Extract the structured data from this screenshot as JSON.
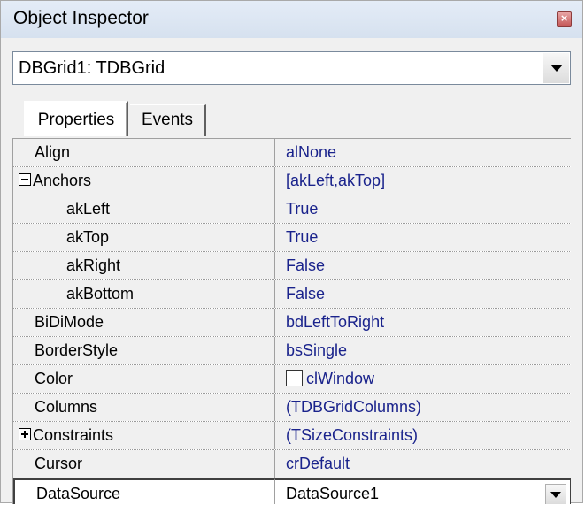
{
  "window": {
    "title": "Object Inspector",
    "close_icon": "close-icon"
  },
  "component_selector": {
    "value": "DBGrid1: TDBGrid"
  },
  "tabs": [
    {
      "label": "Properties",
      "active": true
    },
    {
      "label": "Events",
      "active": false
    }
  ],
  "properties": [
    {
      "name": "Align",
      "value": "alNone",
      "level": 0
    },
    {
      "name": "Anchors",
      "value": "[akLeft,akTop]",
      "level": 0,
      "expander": "minus"
    },
    {
      "name": "akLeft",
      "value": "True",
      "level": 1
    },
    {
      "name": "akTop",
      "value": "True",
      "level": 1
    },
    {
      "name": "akRight",
      "value": "False",
      "level": 1
    },
    {
      "name": "akBottom",
      "value": "False",
      "level": 1
    },
    {
      "name": "BiDiMode",
      "value": "bdLeftToRight",
      "level": 0
    },
    {
      "name": "BorderStyle",
      "value": "bsSingle",
      "level": 0
    },
    {
      "name": "Color",
      "value": "clWindow",
      "level": 0,
      "swatch": "#ffffff"
    },
    {
      "name": "Columns",
      "value": "(TDBGridColumns)",
      "level": 0
    },
    {
      "name": "Constraints",
      "value": "(TSizeConstraints)",
      "level": 0,
      "expander": "plus"
    },
    {
      "name": "Cursor",
      "value": "crDefault",
      "level": 0
    },
    {
      "name": "DataSource",
      "value": "DataSource1",
      "level": 0,
      "selected": true
    }
  ],
  "colors": {
    "value_text": "#1a238c",
    "background": "#f0f0f0"
  }
}
